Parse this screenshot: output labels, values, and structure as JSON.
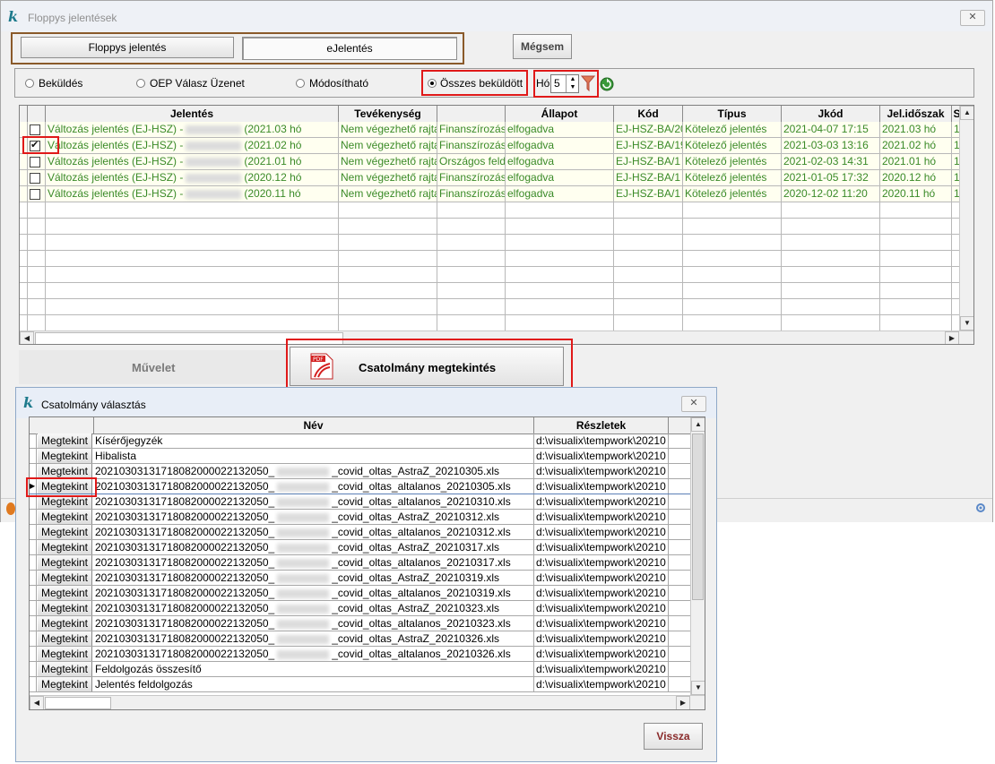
{
  "main_window": {
    "title": "Floppys jelentések",
    "close_glyph": "✕",
    "tabs": [
      {
        "label": "Floppys jelentés"
      },
      {
        "label": "eJelentés"
      }
    ],
    "cancel_label": "Mégsem"
  },
  "filters": {
    "radios": [
      {
        "label": "Beküldés",
        "selected": false
      },
      {
        "label": "OEP Válasz Üzenet",
        "selected": false
      },
      {
        "label": "Módosítható",
        "selected": false
      },
      {
        "label": "Összes beküldött",
        "selected": true
      }
    ],
    "month_label": "Hó",
    "month_value": "5"
  },
  "grid": {
    "columns": [
      "Jelentés",
      "Tevékenység",
      "",
      "Állapot",
      "Kód",
      "Típus",
      "Jkód",
      "Jel.időszak",
      "S"
    ],
    "rows": [
      {
        "checked": false,
        "jel_a": "Változás jelentés (EJ-HSZ) -",
        "jel_b": "(2021.03 hó",
        "tev": "Nem végezhető rajta",
        "tev2": "Finanszírozás",
        "allapot": "elfogadva",
        "kod": "EJ-HSZ-BA/20",
        "tipus": "Kötelező jelentés",
        "jkod": "2021-04-07 17:15",
        "idoszak": "2021.03 hó",
        "s": "1"
      },
      {
        "checked": true,
        "jel_a": "Változás jelentés (EJ-HSZ) -",
        "jel_b": "(2021.02 hó",
        "tev": "Nem végezhető rajta",
        "tev2": "Finanszírozás",
        "allapot": "elfogadva",
        "kod": "EJ-HSZ-BA/19",
        "tipus": "Kötelező jelentés",
        "jkod": "2021-03-03 13:16",
        "idoszak": "2021.02 hó",
        "s": "1"
      },
      {
        "checked": false,
        "jel_a": "Változás jelentés (EJ-HSZ) -",
        "jel_b": "(2021.01 hó",
        "tev": "Nem végezhető rajta",
        "tev2": "Országos feld",
        "allapot": "elfogadva",
        "kod": "EJ-HSZ-BA/1",
        "tipus": "Kötelező jelentés",
        "jkod": "2021-02-03 14:31",
        "idoszak": "2021.01 hó",
        "s": "1"
      },
      {
        "checked": false,
        "jel_a": "Változás jelentés (EJ-HSZ) -",
        "jel_b": "(2020.12 hó",
        "tev": "Nem végezhető rajta",
        "tev2": "Finanszírozás",
        "allapot": "elfogadva",
        "kod": "EJ-HSZ-BA/1",
        "tipus": "Kötelező jelentés",
        "jkod": "2021-01-05 17:32",
        "idoszak": "2020.12 hó",
        "s": "1"
      },
      {
        "checked": false,
        "jel_a": "Változás jelentés (EJ-HSZ) -",
        "jel_b": "(2020.11 hó",
        "tev": "Nem végezhető rajta",
        "tev2": "Finanszírozás",
        "allapot": "elfogadva",
        "kod": "EJ-HSZ-BA/1",
        "tipus": "Kötelező jelentés",
        "jkod": "2020-12-02 11:20",
        "idoszak": "2020.11 hó",
        "s": "1"
      }
    ]
  },
  "actions": {
    "muvelet_label": "Művelet",
    "view_attachment_label": "Csatolmány megtekintés",
    "pdf_badge": "PDF"
  },
  "dialog": {
    "title": "Csatolmány választás",
    "close_glyph": "✕",
    "columns": [
      "Név",
      "Részletek"
    ],
    "view_label": "Megtekint",
    "rows": [
      {
        "a": "Kísérőjegyzék",
        "b": "",
        "res": "d:\\visualix\\tempwork\\20210"
      },
      {
        "a": "Hibalista",
        "b": "",
        "res": "d:\\visualix\\tempwork\\20210"
      },
      {
        "a": "202103031317180820000221320​50_",
        "b": "_covid_oltas_AstraZ_20210305.xls",
        "res": "d:\\visualix\\tempwork\\20210"
      },
      {
        "a": "20210303131718082000022132050_",
        "b": "_covid_oltas_altalanos_20210305.xls",
        "res": "d:\\visualix\\tempwork\\20210",
        "selected": true
      },
      {
        "a": "20210303131718082000022132050_",
        "b": "_covid_oltas_altalanos_20210310.xls",
        "res": "d:\\visualix\\tempwork\\20210"
      },
      {
        "a": "20210303131718082000022132050_",
        "b": "_covid_oltas_AstraZ_20210312.xls",
        "res": "d:\\visualix\\tempwork\\20210"
      },
      {
        "a": "20210303131718082000022132050_",
        "b": "_covid_oltas_altalanos_20210312.xls",
        "res": "d:\\visualix\\tempwork\\20210"
      },
      {
        "a": "20210303131718082000022132050_",
        "b": "_covid_oltas_AstraZ_20210317.xls",
        "res": "d:\\visualix\\tempwork\\20210"
      },
      {
        "a": "20210303131718082000022132050_",
        "b": "_covid_oltas_altalanos_20210317.xls",
        "res": "d:\\visualix\\tempwork\\20210"
      },
      {
        "a": "20210303131718082000022132050_",
        "b": "_covid_oltas_AstraZ_20210319.xls",
        "res": "d:\\visualix\\tempwork\\20210"
      },
      {
        "a": "20210303131718082000022132050_",
        "b": "_covid_oltas_altalanos_20210319.xls",
        "res": "d:\\visualix\\tempwork\\20210"
      },
      {
        "a": "20210303131718082000022132050_",
        "b": "_covid_oltas_AstraZ_20210323.xls",
        "res": "d:\\visualix\\tempwork\\20210"
      },
      {
        "a": "20210303131718082000022132050_",
        "b": "_covid_oltas_altalanos_20210323.xls",
        "res": "d:\\visualix\\tempwork\\20210"
      },
      {
        "a": "20210303131718082000022132050_",
        "b": "_covid_oltas_AstraZ_20210326.xls",
        "res": "d:\\visualix\\tempwork\\20210"
      },
      {
        "a": "20210303131718082000022132050_",
        "b": "_covid_oltas_altalanos_20210326.xls",
        "res": "d:\\visualix\\tempwork\\20210"
      },
      {
        "a": "Feldolgozás összesítő",
        "b": "",
        "res": "d:\\visualix\\tempwork\\20210"
      },
      {
        "a": "Jelentés feldolgozás",
        "b": "",
        "res": "d:\\visualix\\tempwork\\20210"
      }
    ],
    "back_label": "Vissza"
  },
  "colors": {
    "row_text": "#3a8a28",
    "highlight": "#e01919",
    "tab_frame": "#8a5a2a"
  }
}
